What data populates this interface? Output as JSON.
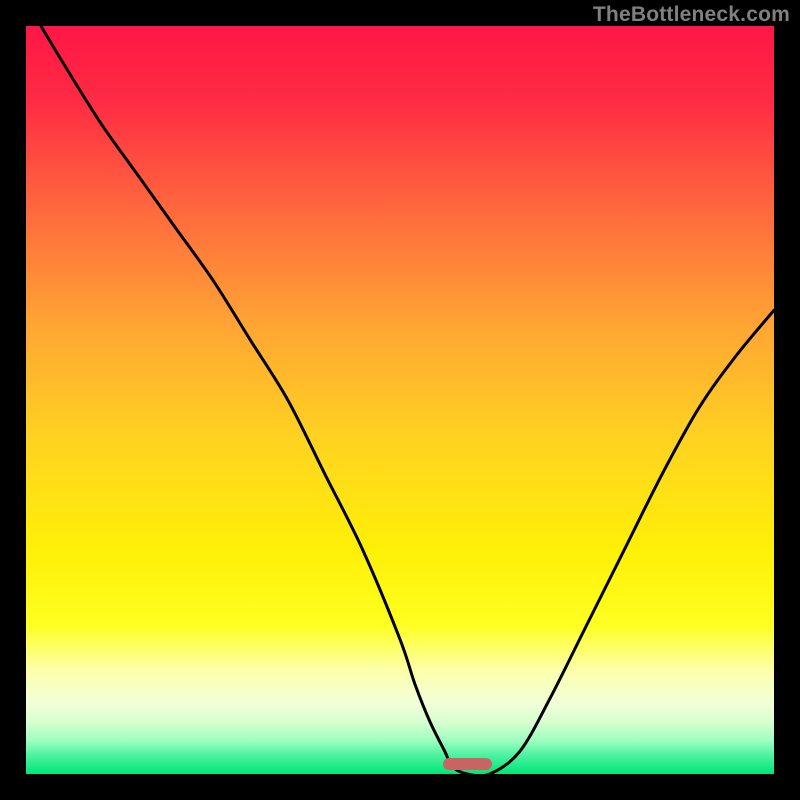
{
  "watermark": "TheBottleneck.com",
  "chart_data": {
    "type": "line",
    "title": "",
    "xlabel": "",
    "ylabel": "",
    "xlim": [
      0,
      100
    ],
    "ylim": [
      0,
      100
    ],
    "series": [
      {
        "name": "bottleneck-curve",
        "x": [
          2,
          5,
          10,
          15,
          20,
          25,
          30,
          35,
          40,
          45,
          50,
          52,
          54,
          56,
          57,
          59,
          62,
          66,
          70,
          75,
          80,
          85,
          90,
          95,
          100
        ],
        "y": [
          100,
          95,
          87,
          80,
          73,
          66,
          58,
          50,
          40,
          30,
          18,
          12,
          7,
          3,
          1,
          0,
          0,
          3,
          10,
          20,
          30,
          40,
          49,
          56,
          62
        ]
      }
    ],
    "marker": {
      "x_center": 59,
      "y": 1.3,
      "width": 6.5,
      "height": 1.6,
      "color": "#c86464"
    },
    "gradient_stops": [
      {
        "pos": 0.0,
        "color": "#ff1745"
      },
      {
        "pos": 0.1,
        "color": "#ff2b44"
      },
      {
        "pos": 0.25,
        "color": "#ff6a3d"
      },
      {
        "pos": 0.4,
        "color": "#ffa534"
      },
      {
        "pos": 0.55,
        "color": "#ffd221"
      },
      {
        "pos": 0.7,
        "color": "#fff007"
      },
      {
        "pos": 0.8,
        "color": "#ffff20"
      },
      {
        "pos": 0.86,
        "color": "#fcffa8"
      },
      {
        "pos": 0.905,
        "color": "#f2ffd8"
      },
      {
        "pos": 0.93,
        "color": "#d8ffcf"
      },
      {
        "pos": 0.955,
        "color": "#9fffc0"
      },
      {
        "pos": 0.975,
        "color": "#4cf2a0"
      },
      {
        "pos": 1.0,
        "color": "#00e676"
      }
    ]
  }
}
